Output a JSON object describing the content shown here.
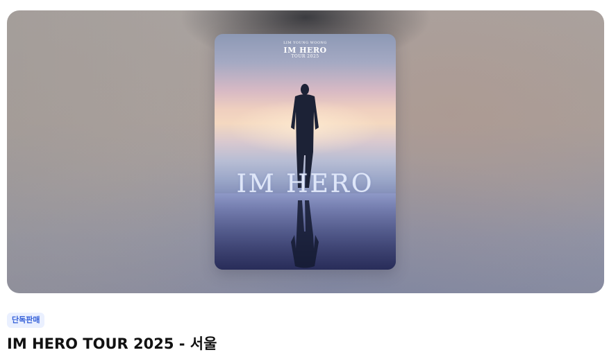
{
  "poster": {
    "artist_line": "LIM YOUNG WOONG",
    "logo": "IM HERO",
    "tour_line": "TOUR 2025",
    "main_title": "IM HERO",
    "alt": "IM HERO TOUR 2025 poster"
  },
  "badge": {
    "label": "단독판매",
    "text_color": "#3560d8",
    "bg_color": "#eaf0ff"
  },
  "event": {
    "title": "IM HERO TOUR 2025 - 서울"
  }
}
